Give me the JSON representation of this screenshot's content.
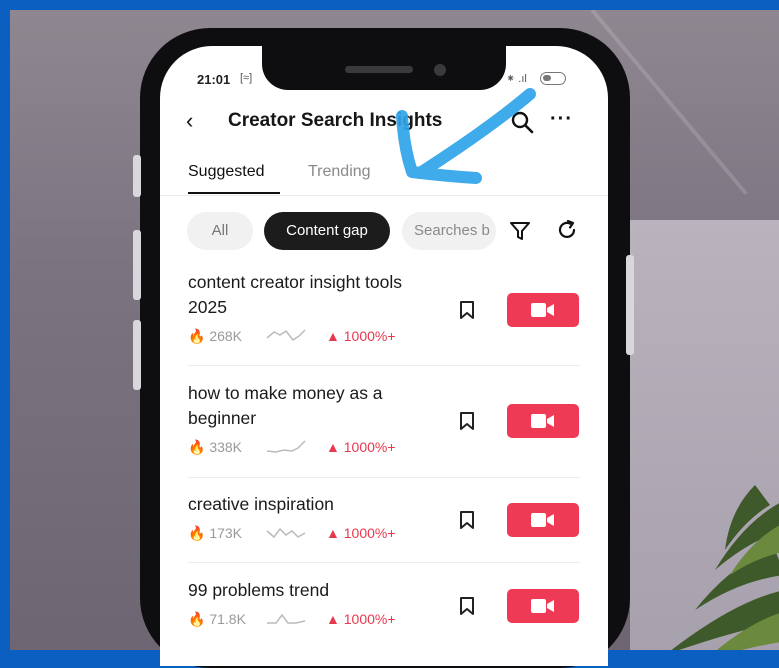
{
  "status": {
    "time": "21:01",
    "left_icon": "[≈]",
    "right_icons": "⁕ .ıl"
  },
  "header": {
    "title": "Creator Search Insights"
  },
  "tabs": [
    {
      "label": "Suggested",
      "active": true
    },
    {
      "label": "Trending",
      "active": false
    }
  ],
  "filters": [
    {
      "label": "All",
      "selected": false
    },
    {
      "label": "Content gap",
      "selected": true
    },
    {
      "label": "Searches b",
      "selected": false
    }
  ],
  "results": [
    {
      "title": "content creator insight tools 2025",
      "views": "268K",
      "trend": "1000%+"
    },
    {
      "title": "how to make money as a beginner",
      "views": "338K",
      "trend": "1000%+"
    },
    {
      "title": "creative inspiration",
      "views": "173K",
      "trend": "1000%+"
    },
    {
      "title": "99 problems trend",
      "views": "71.8K",
      "trend": "1000%+"
    }
  ],
  "colors": {
    "accent": "#ef3a55",
    "annotation": "#2fa4ea",
    "frame": "#0a5fc0"
  }
}
